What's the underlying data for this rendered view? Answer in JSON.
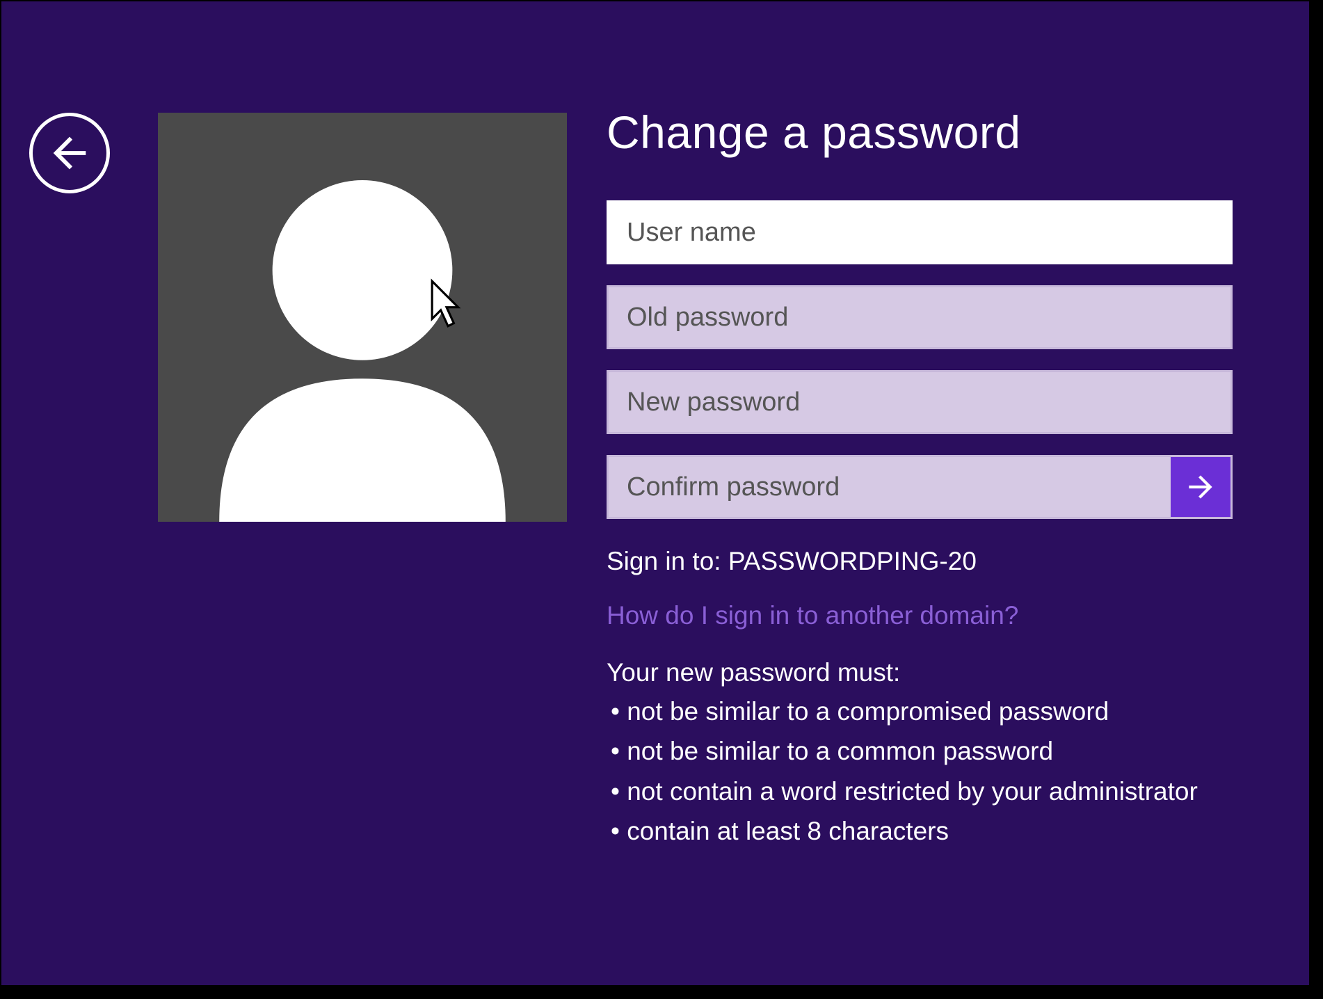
{
  "page": {
    "title": "Change a password"
  },
  "fields": {
    "username": {
      "placeholder": "User name",
      "value": ""
    },
    "old_password": {
      "placeholder": "Old password",
      "value": ""
    },
    "new_password": {
      "placeholder": "New password",
      "value": ""
    },
    "confirm_password": {
      "placeholder": "Confirm password",
      "value": ""
    }
  },
  "info": {
    "sign_in_to_prefix": "Sign in to: ",
    "sign_in_to_domain": "PASSWORDPING-20",
    "help_link": "How do I sign in to another domain?"
  },
  "requirements": {
    "title": "Your new password must:",
    "items": [
      "not be similar to a compromised password",
      "not be similar to a common password",
      "not contain a word restricted by your administrator",
      "contain at least 8 characters"
    ]
  },
  "icons": {
    "back": "arrow-left-icon",
    "submit": "arrow-right-icon",
    "avatar": "person-icon",
    "cursor": "cursor-icon"
  },
  "colors": {
    "background": "#2b0e5e",
    "input_inactive": "#d6c9e4",
    "input_active": "#ffffff",
    "submit_button": "#6b2fd6",
    "link": "#8a5fd6"
  }
}
